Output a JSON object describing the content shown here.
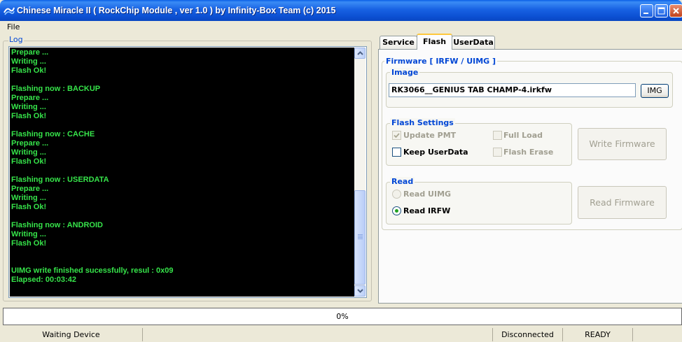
{
  "window": {
    "title": "Chinese Miracle II ( RockChip Module , ver 1.0 ) by Infinity-Box Team (c) 2015",
    "icon": "app-logo-icon",
    "controls": [
      "minimize-icon",
      "maximize-icon",
      "close-icon"
    ]
  },
  "menu": {
    "items": [
      {
        "label": "File"
      }
    ]
  },
  "log": {
    "label": "Log",
    "lines": [
      "Prepare ...",
      "Writing ...",
      "Flash Ok!",
      "",
      "Flashing now : BACKUP",
      "Prepare ...",
      "Writing ...",
      "Flash Ok!",
      "",
      "Flashing now : CACHE",
      "Prepare ...",
      "Writing ...",
      "Flash Ok!",
      "",
      "Flashing now : USERDATA",
      "Prepare ...",
      "Writing ...",
      "Flash Ok!",
      "",
      "Flashing now : ANDROID",
      "Writing ...",
      "Flash Ok!",
      "",
      "",
      "UIMG write finished sucessfully, resul : 0x09",
      "Elapsed: 00:03:42"
    ],
    "text_color": "#36e44a",
    "background": "#000000"
  },
  "tabs": [
    {
      "label": "Service",
      "active": false
    },
    {
      "label": "Flash",
      "active": true
    },
    {
      "label": "UserData",
      "active": false
    }
  ],
  "flash": {
    "firmware_legend": "Firmware [ IRFW / UIMG ]",
    "image": {
      "legend": "Image",
      "path_value": "RK3066__GENIUS TAB CHAMP-4.irkfw",
      "button_label": "IMG"
    },
    "settings": {
      "legend": "Flash Settings",
      "options": [
        {
          "label": "Update PMT",
          "checked": true,
          "enabled": false
        },
        {
          "label": "Full Load",
          "checked": false,
          "enabled": false
        },
        {
          "label": "Keep UserData",
          "checked": false,
          "enabled": true
        },
        {
          "label": "Flash Erase",
          "checked": false,
          "enabled": false
        }
      ],
      "write_button": "Write Firmware"
    },
    "read": {
      "legend": "Read",
      "options": [
        {
          "label": "Read UIMG",
          "selected": false,
          "enabled": false
        },
        {
          "label": "Read IRFW",
          "selected": true,
          "enabled": true
        }
      ],
      "read_button": "Read Firmware"
    }
  },
  "progress": {
    "text": "0%",
    "value": 0
  },
  "status": {
    "device": "Waiting Device",
    "connection": "Disconnected",
    "state": "READY"
  }
}
